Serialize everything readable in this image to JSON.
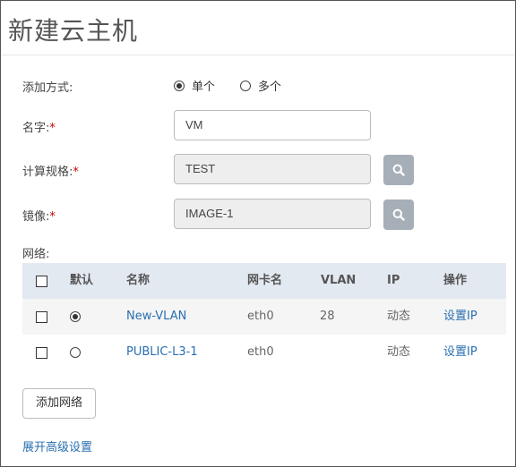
{
  "header": {
    "title": "新建云主机"
  },
  "form": {
    "mode_label": "添加方式:",
    "mode_options": [
      {
        "label": "单个",
        "selected": true
      },
      {
        "label": "多个",
        "selected": false
      }
    ],
    "name_label": "名字:",
    "name_value": "VM",
    "spec_label": "计算规格:",
    "spec_value": "TEST",
    "image_label": "镜像:",
    "image_value": "IMAGE-1",
    "required_mark": "*",
    "network_label": "网络:"
  },
  "network_table": {
    "columns": [
      "默认",
      "名称",
      "网卡名",
      "VLAN",
      "IP",
      "操作"
    ],
    "rows": [
      {
        "default": true,
        "name": "New-VLAN",
        "nic": "eth0",
        "vlan": "28",
        "ip": "动态",
        "action": "设置IP"
      },
      {
        "default": false,
        "name": "PUBLIC-L3-1",
        "nic": "eth0",
        "vlan": "",
        "ip": "动态",
        "action": "设置IP"
      }
    ]
  },
  "buttons": {
    "add_network": "添加网络",
    "advanced": "展开高级设置"
  },
  "icons": {
    "search": "search-icon"
  },
  "colors": {
    "link": "#2a6fb0",
    "required": "#cc0000",
    "table_header_bg": "#e3e9f1",
    "search_button_bg": "#a6aeb7"
  }
}
